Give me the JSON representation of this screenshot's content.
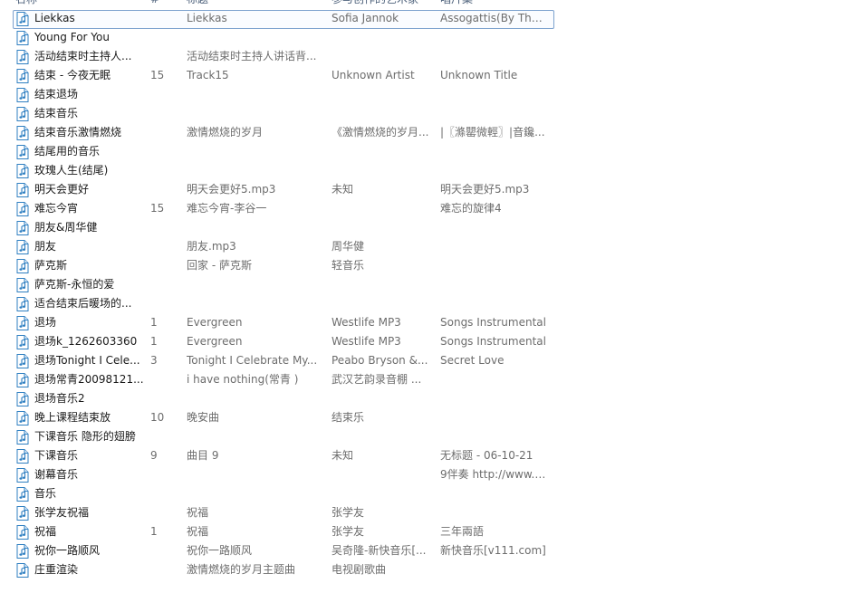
{
  "columns": {
    "name": "名称",
    "number": "#",
    "title": "标题",
    "contributing_artist": "参与创作的艺术家",
    "album": "唱片集"
  },
  "rows": [
    {
      "name": "Liekkas",
      "number": "",
      "title": "Liekkas",
      "artist": "Sofia Jannok",
      "album": "Assogattis(By The ...",
      "selected": true
    },
    {
      "name": "Young For You",
      "number": "",
      "title": "",
      "artist": "",
      "album": ""
    },
    {
      "name": "活动结束时主持人...",
      "number": "",
      "title": "活动结束时主持人讲话背...",
      "artist": "",
      "album": ""
    },
    {
      "name": "结束 - 今夜无眠",
      "number": "15",
      "title": "Track15",
      "artist": "Unknown Artist",
      "album": "Unknown Title"
    },
    {
      "name": "结束退场",
      "number": "",
      "title": "",
      "artist": "",
      "album": ""
    },
    {
      "name": "结束音乐",
      "number": "",
      "title": "",
      "artist": "",
      "album": ""
    },
    {
      "name": "结束音乐激情燃烧",
      "number": "",
      "title": "激情燃烧的岁月",
      "artist": "《激情燃烧的岁月...",
      "album": "|〖滌罌微輕〗|音鑱..."
    },
    {
      "name": "结尾用的音乐",
      "number": "",
      "title": "",
      "artist": "",
      "album": ""
    },
    {
      "name": "玫瑰人生(结尾)",
      "number": "",
      "title": "",
      "artist": "",
      "album": ""
    },
    {
      "name": "明天会更好",
      "number": "",
      "title": "明天会更好5.mp3",
      "artist": "未知",
      "album": "明天会更好5.mp3"
    },
    {
      "name": "难忘今宵",
      "number": "15",
      "title": "难忘今宵-李谷一",
      "artist": "",
      "album": "难忘的旋律4"
    },
    {
      "name": "朋友&周华健",
      "number": "",
      "title": "",
      "artist": "",
      "album": ""
    },
    {
      "name": "朋友",
      "number": "",
      "title": "朋友.mp3",
      "artist": "周华健",
      "album": ""
    },
    {
      "name": "萨克斯",
      "number": "",
      "title": "回家 - 萨克斯",
      "artist": "轻音乐",
      "album": ""
    },
    {
      "name": "萨克斯-永恒的爱",
      "number": "",
      "title": "",
      "artist": "",
      "album": ""
    },
    {
      "name": "适合结束后暖场的...",
      "number": "",
      "title": "",
      "artist": "",
      "album": ""
    },
    {
      "name": "退场",
      "number": "1",
      "title": "Evergreen",
      "artist": "Westlife MP3",
      "album": "Songs Instrumental"
    },
    {
      "name": "退场k_1262603360",
      "number": "1",
      "title": "Evergreen",
      "artist": "Westlife MP3",
      "album": "Songs Instrumental"
    },
    {
      "name": "退场Tonight I Cele...",
      "number": "3",
      "title": "Tonight I Celebrate My...",
      "artist": "Peabo Bryson &...",
      "album": "Secret Love"
    },
    {
      "name": "退场常青20098121...",
      "number": "",
      "title": "i have nothing(常青 )",
      "artist": "武汉艺韵录音棚 ...",
      "album": ""
    },
    {
      "name": "退场音乐2",
      "number": "",
      "title": "",
      "artist": "",
      "album": ""
    },
    {
      "name": "晚上课程结束放",
      "number": "10",
      "title": "晚安曲",
      "artist": "结束乐",
      "album": ""
    },
    {
      "name": "下课音乐 隐形的翅膀",
      "number": "",
      "title": "",
      "artist": "",
      "album": ""
    },
    {
      "name": "下课音乐",
      "number": "9",
      "title": "曲目 9",
      "artist": "未知",
      "album": "无标题 - 06-10-21"
    },
    {
      "name": "谢幕音乐",
      "number": "",
      "title": "",
      "artist": "",
      "album": "9伴奏 http://www.9..."
    },
    {
      "name": "音乐",
      "number": "",
      "title": "",
      "artist": "",
      "album": ""
    },
    {
      "name": "张学友祝福",
      "number": "",
      "title": "祝福",
      "artist": "张学友",
      "album": ""
    },
    {
      "name": "祝福",
      "number": "1",
      "title": "祝福",
      "artist": "张学友",
      "album": "三年兩語"
    },
    {
      "name": "祝你一路顺风",
      "number": "",
      "title": "祝你一路顺风",
      "artist": "吴奇隆-新快音乐[...",
      "album": "新快音乐[v111.com]"
    },
    {
      "name": "庄重渲染",
      "number": "",
      "title": "激情燃烧的岁月主题曲",
      "artist": "电视剧歌曲",
      "album": ""
    }
  ],
  "icon": "audio-file-icon",
  "colors": {
    "selection_border": "#7da2ce",
    "header_text": "#4c607a",
    "detail_text": "#6d6d6d",
    "icon_blue": "#2f7fc1"
  }
}
